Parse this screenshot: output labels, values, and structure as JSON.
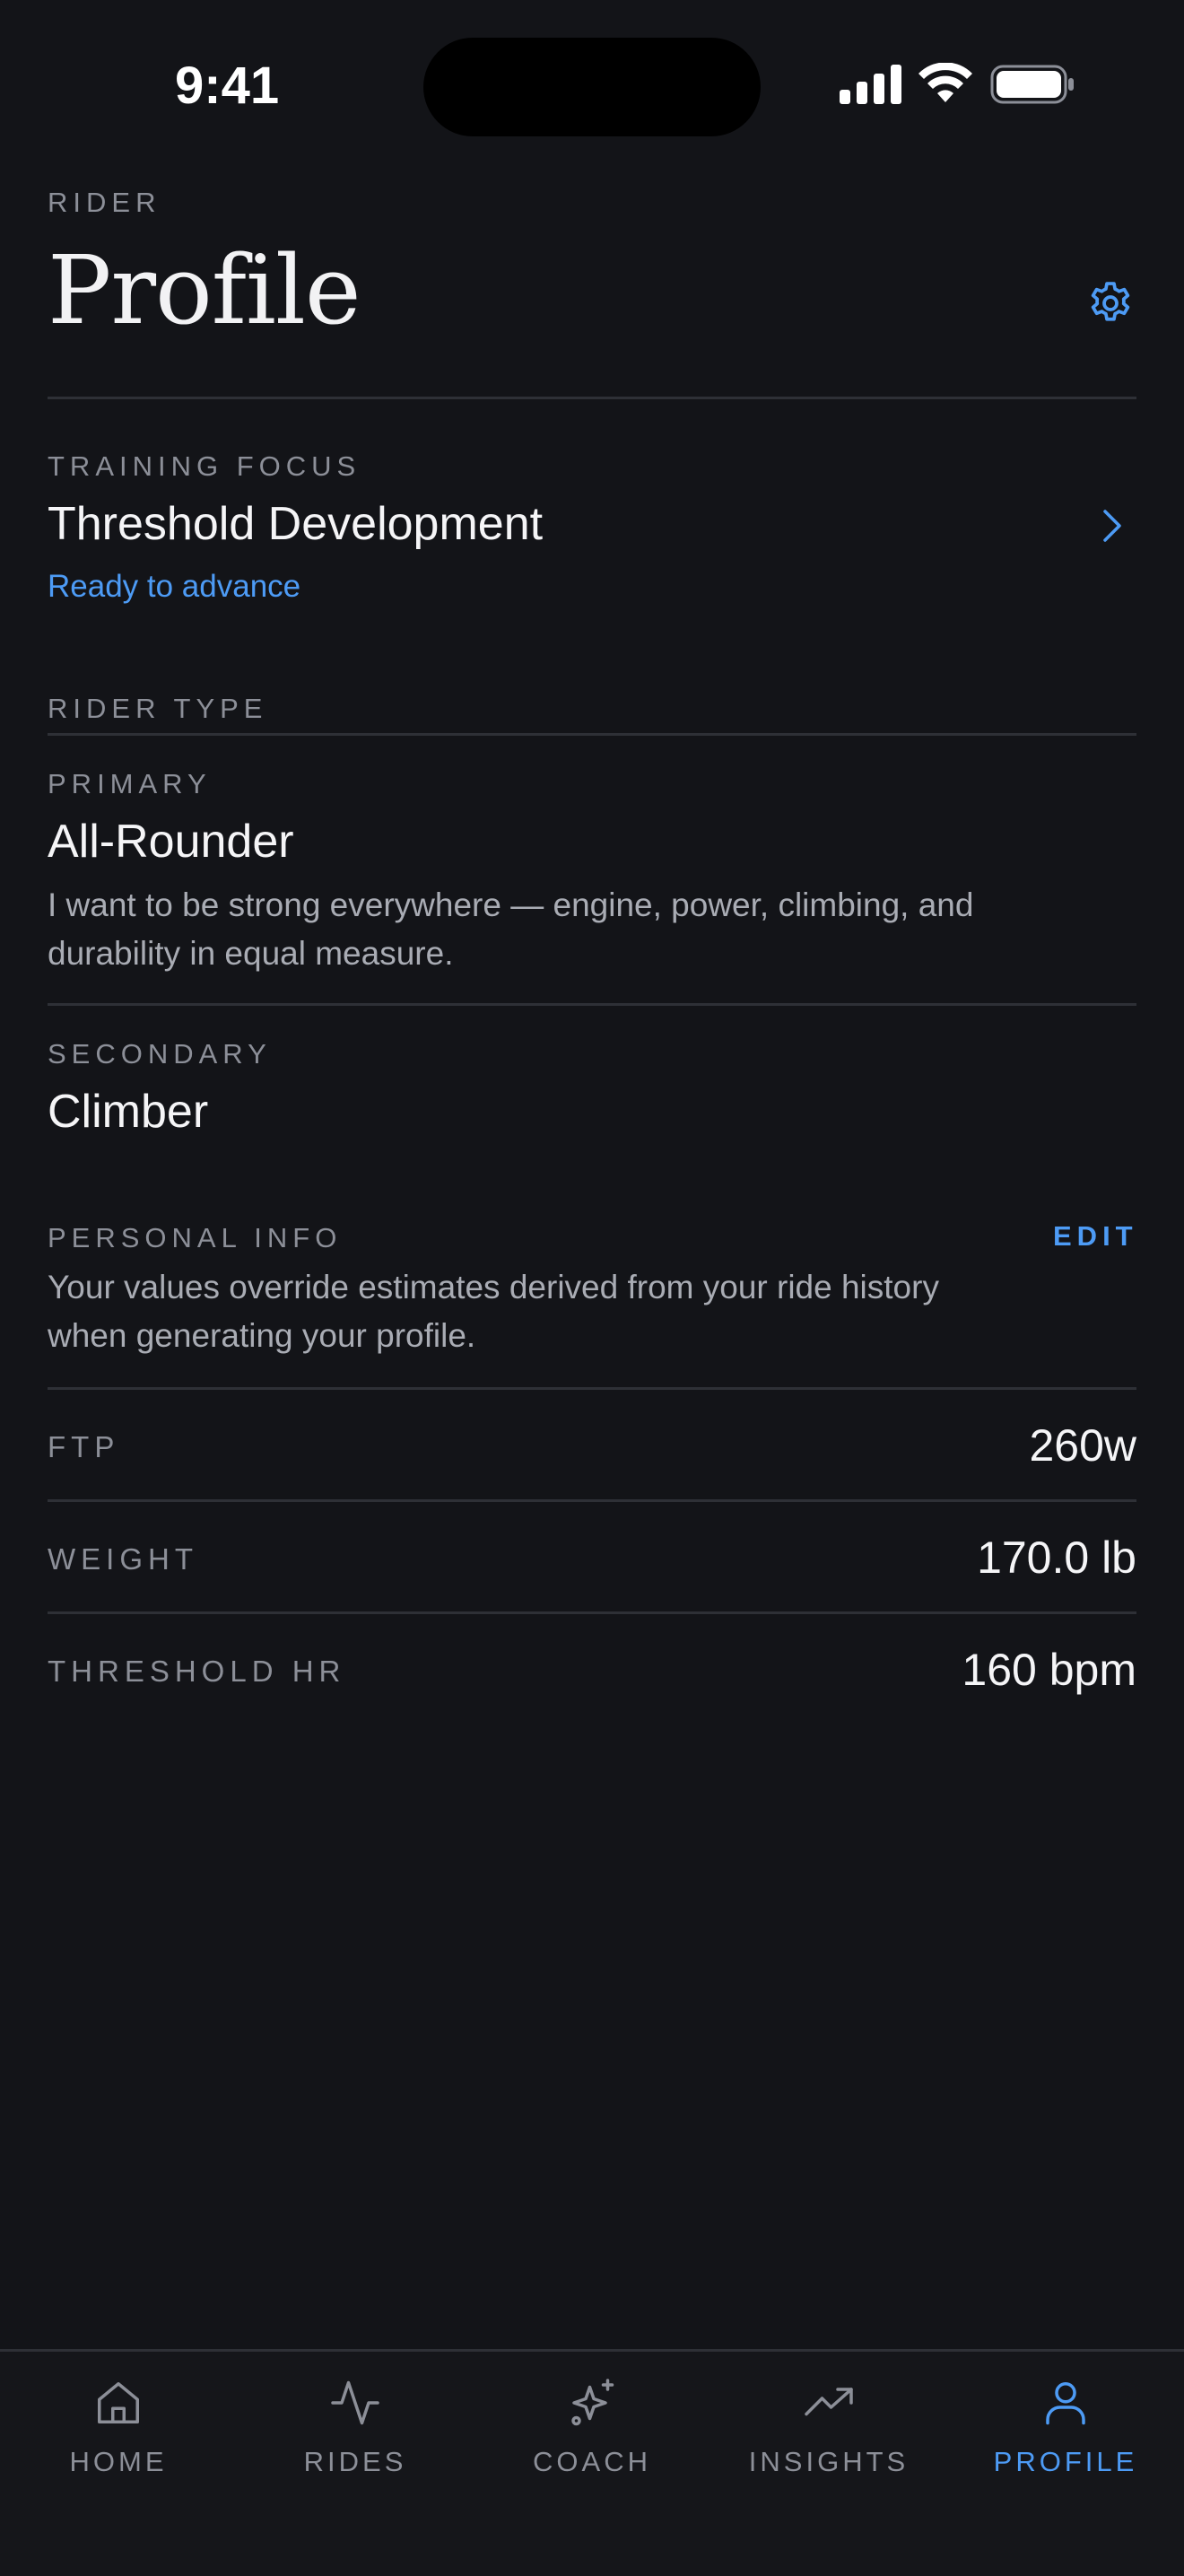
{
  "status_bar": {
    "time": "9:41"
  },
  "header": {
    "eyebrow": "RIDER",
    "title": "Profile"
  },
  "training_focus": {
    "label": "TRAINING FOCUS",
    "value": "Threshold Development",
    "status": "Ready to advance",
    "status_color": "#4d9bf5"
  },
  "rider_type": {
    "label": "RIDER TYPE",
    "primary": {
      "label": "PRIMARY",
      "value": "All-Rounder",
      "description_line1": "I want to be strong everywhere — engine, power, climbing, and",
      "description_line2": "durability in equal measure."
    },
    "secondary": {
      "label": "SECONDARY",
      "value": "Climber"
    }
  },
  "personal_info": {
    "label": "PERSONAL INFO",
    "edit_label": "EDIT",
    "note_line1": "Your values override estimates derived from your ride history",
    "note_line2": "when generating your profile.",
    "rows": [
      {
        "label": "FTP",
        "value": "260w"
      },
      {
        "label": "WEIGHT",
        "value": "170.0 lb"
      },
      {
        "label": "THRESHOLD HR",
        "value": "160 bpm"
      }
    ]
  },
  "tabs": [
    {
      "label": "HOME",
      "icon": "home-icon",
      "active": false
    },
    {
      "label": "RIDES",
      "icon": "activity-icon",
      "active": false
    },
    {
      "label": "COACH",
      "icon": "sparkle-icon",
      "active": false
    },
    {
      "label": "INSIGHTS",
      "icon": "trending-icon",
      "active": false
    },
    {
      "label": "PROFILE",
      "icon": "user-icon",
      "active": true
    }
  ],
  "colors": {
    "background": "#131418",
    "accent": "#4d9bf5",
    "muted": "#8c8f98"
  }
}
